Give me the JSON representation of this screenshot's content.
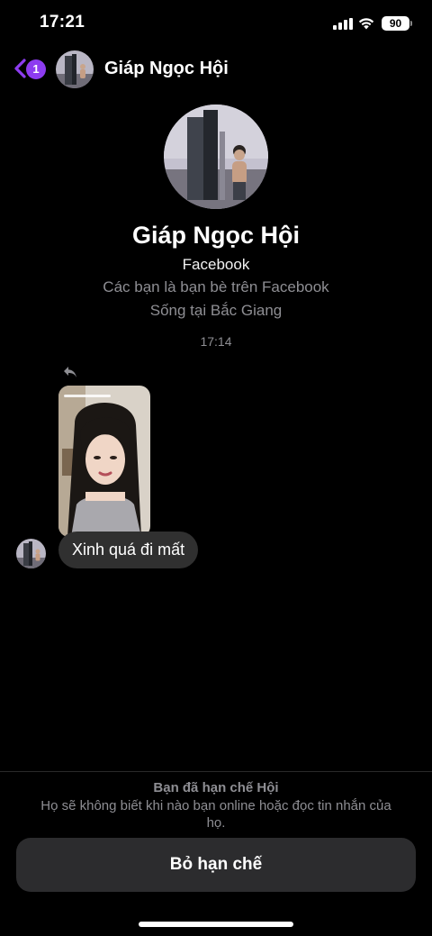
{
  "status_bar": {
    "time": "17:21",
    "battery": "90"
  },
  "header": {
    "unread_count": "1",
    "contact_name": "Giáp Ngọc Hội"
  },
  "profile": {
    "name": "Giáp Ngọc Hội",
    "platform": "Facebook",
    "friends_info": "Các bạn là bạn bè trên Facebook",
    "location": "Sống tại Bắc Giang"
  },
  "conversation": {
    "timestamp": "17:14",
    "messages": [
      {
        "text": "Xinh quá đi mất"
      }
    ]
  },
  "restriction": {
    "title": "Bạn đã hạn chế Hội",
    "description": "Họ sẽ không biết khi nào bạn online hoặc đọc tin nhắn của họ.",
    "button_label": "Bỏ hạn chế"
  },
  "colors": {
    "accent": "#8d3cf0",
    "bubble": "#303030",
    "muted_text": "#8e8e93"
  }
}
